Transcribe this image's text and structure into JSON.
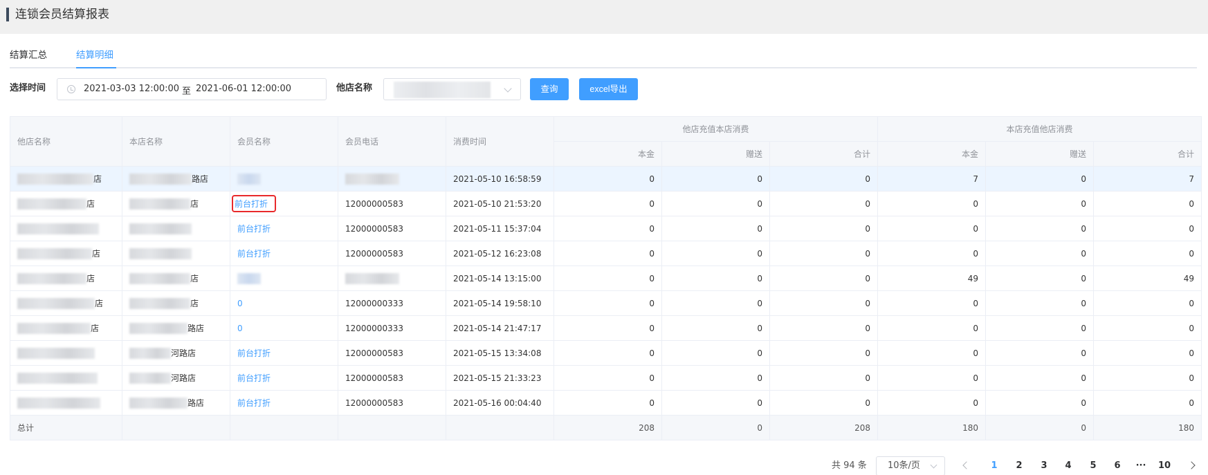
{
  "header": {
    "title": "连锁会员结算报表"
  },
  "tabs": [
    {
      "label": "结算汇总",
      "active": false
    },
    {
      "label": "结算明细",
      "active": true
    }
  ],
  "filters": {
    "time_label": "选择时间",
    "date_start": "2021-03-03 12:00:00",
    "date_sep": "至",
    "date_end": "2021-06-01 12:00:00",
    "store_label": "他店名称",
    "query_label": "查询",
    "export_label": "excel导出"
  },
  "table": {
    "columns": {
      "other_store": "他店名称",
      "this_store": "本店名称",
      "member_name": "会员名称",
      "member_phone": "会员电话",
      "consume_time": "消费时间",
      "group1": "他店充值本店消费",
      "group2": "本店充值他店消费",
      "principal": "本金",
      "bonus": "赠送",
      "total": "合计"
    },
    "rows": [
      {
        "other_suffix": "店",
        "this_suffix": "路店",
        "member": "",
        "phone": "",
        "time": "2021-05-10 16:58:59",
        "a1": "0",
        "a2": "0",
        "a3": "0",
        "b1": "7",
        "b2": "0",
        "b3": "7"
      },
      {
        "other_suffix": "店",
        "this_suffix": "店",
        "member": "前台打折",
        "phone": "12000000583",
        "time": "2021-05-10 21:53:20",
        "a1": "0",
        "a2": "0",
        "a3": "0",
        "b1": "0",
        "b2": "0",
        "b3": "0"
      },
      {
        "other_suffix": "",
        "this_suffix": "",
        "member": "前台打折",
        "phone": "12000000583",
        "time": "2021-05-11 15:37:04",
        "a1": "0",
        "a2": "0",
        "a3": "0",
        "b1": "0",
        "b2": "0",
        "b3": "0"
      },
      {
        "other_suffix": "店",
        "this_suffix": "",
        "member": "前台打折",
        "phone": "12000000583",
        "time": "2021-05-12 16:23:08",
        "a1": "0",
        "a2": "0",
        "a3": "0",
        "b1": "0",
        "b2": "0",
        "b3": "0"
      },
      {
        "other_suffix": "店",
        "this_suffix": "店",
        "member": "",
        "phone": "",
        "time": "2021-05-14 13:15:00",
        "a1": "0",
        "a2": "0",
        "a3": "0",
        "b1": "49",
        "b2": "0",
        "b3": "49"
      },
      {
        "other_suffix": "店",
        "this_suffix": "店",
        "member": "0",
        "phone": "12000000333",
        "time": "2021-05-14 19:58:10",
        "a1": "0",
        "a2": "0",
        "a3": "0",
        "b1": "0",
        "b2": "0",
        "b3": "0"
      },
      {
        "other_suffix": "店",
        "this_suffix": "路店",
        "member": "0",
        "phone": "12000000333",
        "time": "2021-05-14 21:47:17",
        "a1": "0",
        "a2": "0",
        "a3": "0",
        "b1": "0",
        "b2": "0",
        "b3": "0"
      },
      {
        "other_suffix": "",
        "this_suffix": "河路店",
        "member": "前台打折",
        "phone": "12000000583",
        "time": "2021-05-15 13:34:08",
        "a1": "0",
        "a2": "0",
        "a3": "0",
        "b1": "0",
        "b2": "0",
        "b3": "0"
      },
      {
        "other_suffix": "",
        "this_suffix": "河路店",
        "member": "前台打折",
        "phone": "12000000583",
        "time": "2021-05-15 21:33:23",
        "a1": "0",
        "a2": "0",
        "a3": "0",
        "b1": "0",
        "b2": "0",
        "b3": "0"
      },
      {
        "other_suffix": "",
        "this_suffix": "路店",
        "member": "前台打折",
        "phone": "12000000583",
        "time": "2021-05-16 00:04:40",
        "a1": "0",
        "a2": "0",
        "a3": "0",
        "b1": "0",
        "b2": "0",
        "b3": "0"
      }
    ],
    "footer": {
      "label": "总计",
      "a1": "208",
      "a2": "0",
      "a3": "208",
      "b1": "180",
      "b2": "0",
      "b3": "180"
    }
  },
  "pagination": {
    "total_text": "共 94 条",
    "page_size": "10条/页",
    "pages": [
      "1",
      "2",
      "3",
      "4",
      "5",
      "6"
    ],
    "ellipsis": "···",
    "last_page": "10",
    "current": "1"
  },
  "colors": {
    "primary": "#409eff",
    "highlight_box": "#e8292b"
  }
}
